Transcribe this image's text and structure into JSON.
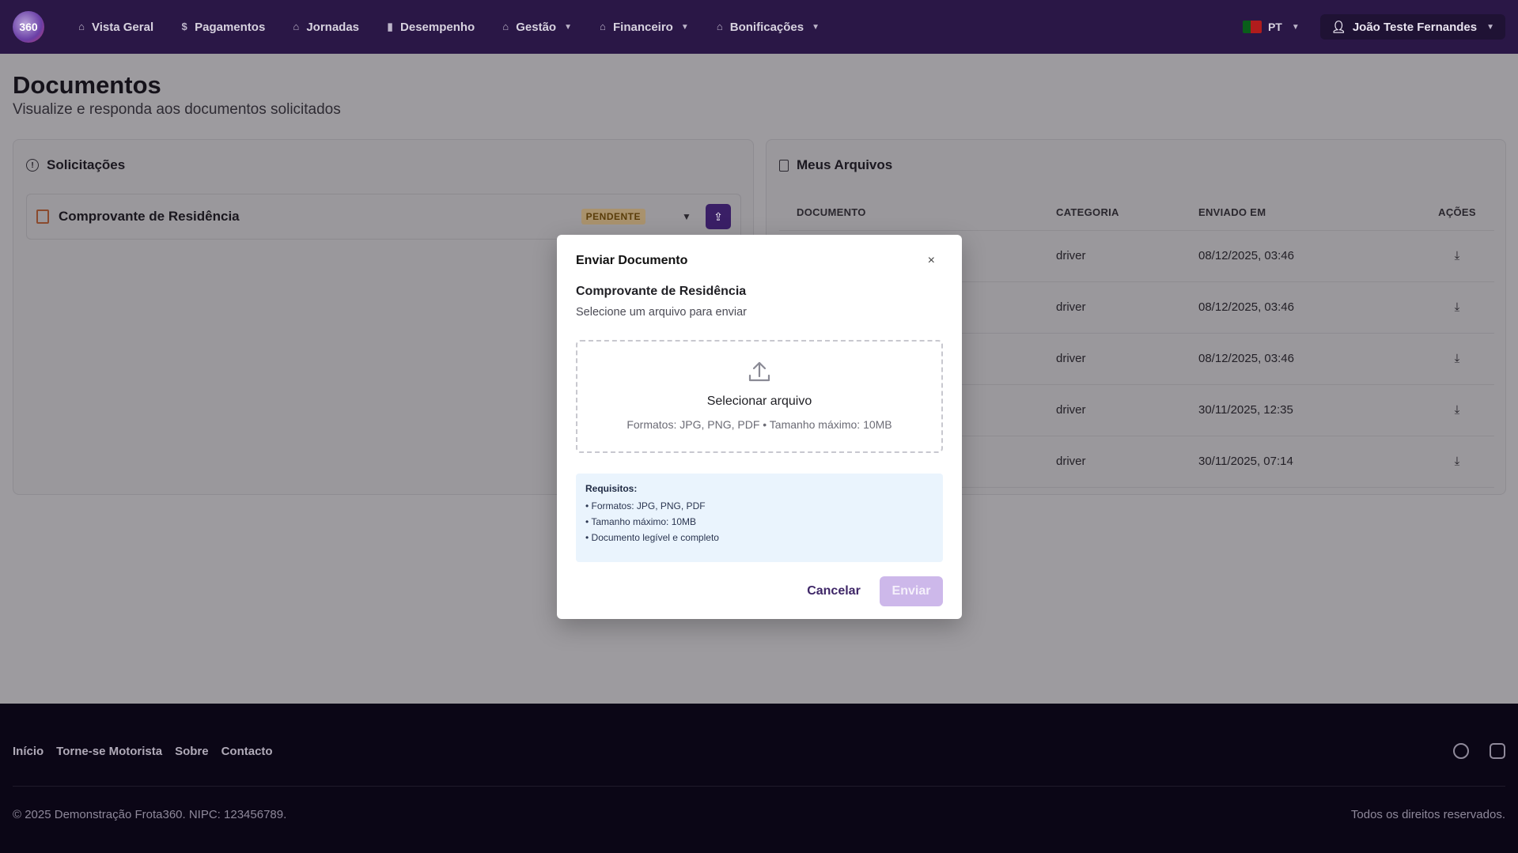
{
  "nav": {
    "logo_text": "360",
    "items": [
      {
        "label": "Vista Geral",
        "icon": "home-icon",
        "dropdown": false
      },
      {
        "label": "Pagamentos",
        "icon": "dollar-icon",
        "dropdown": false
      },
      {
        "label": "Jornadas",
        "icon": "home-icon",
        "dropdown": false
      },
      {
        "label": "Desempenho",
        "icon": "bar-chart-icon",
        "dropdown": false
      },
      {
        "label": "Gestão",
        "icon": "home-icon",
        "dropdown": true
      },
      {
        "label": "Financeiro",
        "icon": "home-icon",
        "dropdown": true
      },
      {
        "label": "Bonificações",
        "icon": "home-icon",
        "dropdown": true
      }
    ],
    "language": "PT",
    "user_name": "João Teste Fernandes"
  },
  "page": {
    "title": "Documentos",
    "subtitle": "Visualize e responda aos documentos solicitados"
  },
  "requests": {
    "title": "Solicitações",
    "items": [
      {
        "name": "Comprovante de Residência",
        "status": "PENDENTE"
      }
    ]
  },
  "files": {
    "title": "Meus Arquivos",
    "columns": [
      "DOCUMENTO",
      "CATEGORIA",
      "ENVIADO EM",
      "AÇÕES"
    ],
    "rows": [
      {
        "document": "",
        "category": "driver",
        "sent_at": "08/12/2025, 03:46"
      },
      {
        "document": "",
        "category": "driver",
        "sent_at": "08/12/2025, 03:46"
      },
      {
        "document": "",
        "category": "driver",
        "sent_at": "08/12/2025, 03:46"
      },
      {
        "document": "",
        "category": "driver",
        "sent_at": "30/11/2025, 12:35"
      },
      {
        "document": "",
        "category": "driver",
        "sent_at": "30/11/2025, 07:14"
      }
    ]
  },
  "modal": {
    "title": "Enviar Documento",
    "close": "×",
    "document_name": "Comprovante de Residência",
    "subtitle": "Selecione um arquivo para enviar",
    "dropzone_label": "Selecionar arquivo",
    "dropzone_hint": "Formatos: JPG, PNG, PDF • Tamanho máximo: 10MB",
    "requirements_title": "Requisitos:",
    "requirements": [
      "• Formatos: JPG, PNG, PDF",
      "• Tamanho máximo: 10MB",
      "• Documento legível e completo"
    ],
    "cancel": "Cancelar",
    "submit": "Enviar"
  },
  "footer": {
    "links": [
      "Início",
      "Torne-se Motorista",
      "Sobre",
      "Contacto"
    ],
    "copyright": "© 2025 Demonstração Frota360. NIPC: 123456789.",
    "rights": "Todos os direitos reservados.",
    "social": [
      "facebook-icon",
      "instagram-icon"
    ]
  },
  "colors": {
    "nav_bg": "#2a1746",
    "accent": "#3a1f66",
    "badge": "#a9926d",
    "footer_bg": "#0b0616",
    "submit_disabled": "#cdb8ea",
    "requirements_bg": "#eaf4fd"
  }
}
